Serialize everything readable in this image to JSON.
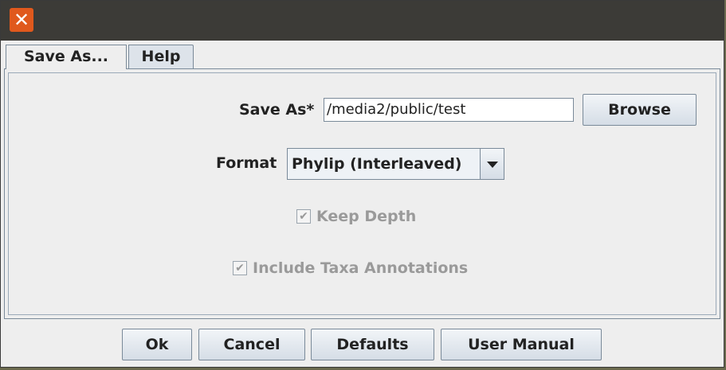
{
  "window": {
    "close_glyph": "✕"
  },
  "tabs": [
    {
      "label": "Save As...",
      "active": true
    },
    {
      "label": "Help",
      "active": false
    }
  ],
  "form": {
    "save_as_label": "Save As*",
    "save_as_value": "/media2/public/test",
    "browse_label": "Browse",
    "format_label": "Format",
    "format_value": "Phylip (Interleaved)",
    "keep_depth_label": "Keep Depth",
    "keep_depth_checked": true,
    "include_taxa_label": "Include Taxa Annotations",
    "include_taxa_checked": true,
    "check_glyph": "✔"
  },
  "buttons": {
    "ok": "Ok",
    "cancel": "Cancel",
    "defaults": "Defaults",
    "user_manual": "User Manual"
  },
  "colors": {
    "titlebar": "#3c3b37",
    "close_button": "#e0591d",
    "window_bg": "#eeeeee",
    "border": "#7a8a99"
  }
}
